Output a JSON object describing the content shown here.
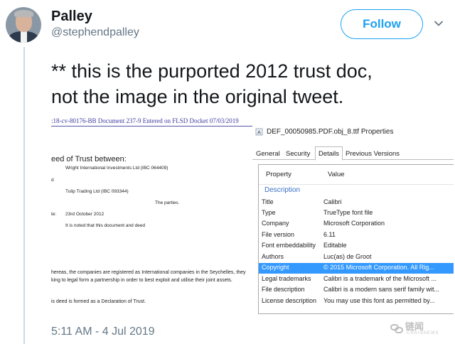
{
  "user": {
    "display_name": "Palley",
    "handle": "@stephendpalley"
  },
  "actions": {
    "follow_label": "Follow"
  },
  "tweet": {
    "line1": "** this is the purported 2012 trust doc,",
    "line2": "not the image in the original tweet.",
    "timestamp": "5:11 AM - 4 Jul 2019"
  },
  "document": {
    "header": ":18-cv-80176-BB   Document 237-9   Entered on FLSD Docket 07/03/2019",
    "lines": [
      "eed of Trust between:",
      "Wright International Investments Ltd (IBC 064409)",
      "d",
      "Tulip Trading Ltd (IBC 093344)",
      "The parties.",
      "te:",
      "23rd October 2012",
      "It is noted that this document and deed",
      "hereas, the companies are registered as International companies in the Seychelles, they",
      "king to legal form a partnership in order to best exploit and utilise their joint assets.",
      "is deed is formed as a Declaration of Trust."
    ]
  },
  "properties_dialog": {
    "title": "DEF_00050985.PDF.obj_8.ttf Properties",
    "tabs": [
      "General",
      "Security",
      "Details",
      "Previous Versions"
    ],
    "active_tab": "Details",
    "col_property": "Property",
    "col_value": "Value",
    "group_label": "Description",
    "rows": [
      {
        "key": "Title",
        "value": "Calibri"
      },
      {
        "key": "Type",
        "value": "TrueType font file"
      },
      {
        "key": "Company",
        "value": "Microsoft Corporation"
      },
      {
        "key": "File version",
        "value": "6.11"
      },
      {
        "key": "Font embeddability",
        "value": "Editable"
      },
      {
        "key": "Authors",
        "value": "Luc(as) de Groot"
      },
      {
        "key": "Copyright",
        "value": "© 2015 Microsoft Corporation. All Rig..."
      },
      {
        "key": "Legal trademarks",
        "value": "Calibri is a trademark of the Microsoft ..."
      },
      {
        "key": "File description",
        "value": "Calibri is a modern sans serif family wit..."
      },
      {
        "key": "License description",
        "value": "You may use this font as permitted by..."
      }
    ],
    "selected_row": "Copyright",
    "selection_color": "#3399ff"
  },
  "colors": {
    "accent": "#1da1f2",
    "muted": "#657786"
  },
  "watermark": {
    "text": "链闻",
    "sub": "CHAINNEWS"
  }
}
